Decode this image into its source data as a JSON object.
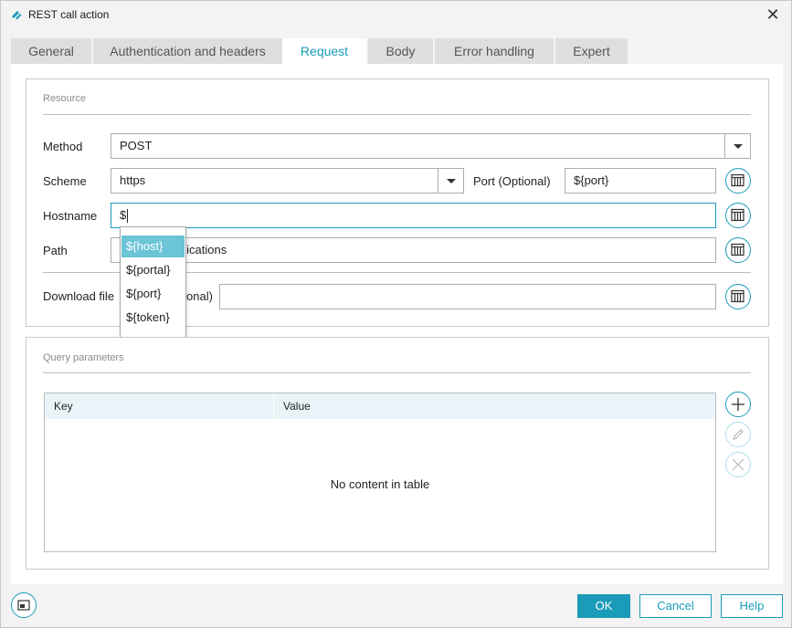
{
  "window": {
    "title": "REST call action"
  },
  "tabs": [
    {
      "label": "General"
    },
    {
      "label": "Authentication and headers"
    },
    {
      "label": "Request"
    },
    {
      "label": "Body"
    },
    {
      "label": "Error handling"
    },
    {
      "label": "Expert"
    }
  ],
  "active_tab": "Request",
  "resource": {
    "title": "Resource",
    "method": {
      "label": "Method",
      "value": "POST"
    },
    "scheme": {
      "label": "Scheme",
      "value": "https"
    },
    "port": {
      "label": "Port (Optional)",
      "value": "${port}"
    },
    "hostname": {
      "label": "Hostname",
      "value": "$"
    },
    "path": {
      "label": "Path",
      "value": "plications"
    },
    "download": {
      "label": "Download file (Optional)",
      "label_visible_start": "Download file",
      "label_visible_end": "onal)",
      "value": ""
    }
  },
  "autocomplete": {
    "items": [
      "${host}",
      "${portal}",
      "${port}",
      "${token}"
    ],
    "selected": "${host}"
  },
  "query": {
    "title": "Query parameters",
    "columns": [
      "Key",
      "Value"
    ],
    "empty_text": "No content in table"
  },
  "footer": {
    "ok": "OK",
    "cancel": "Cancel",
    "help": "Help"
  },
  "colors": {
    "accent": "#1a9bb7",
    "selection": "#6cc4d7"
  }
}
